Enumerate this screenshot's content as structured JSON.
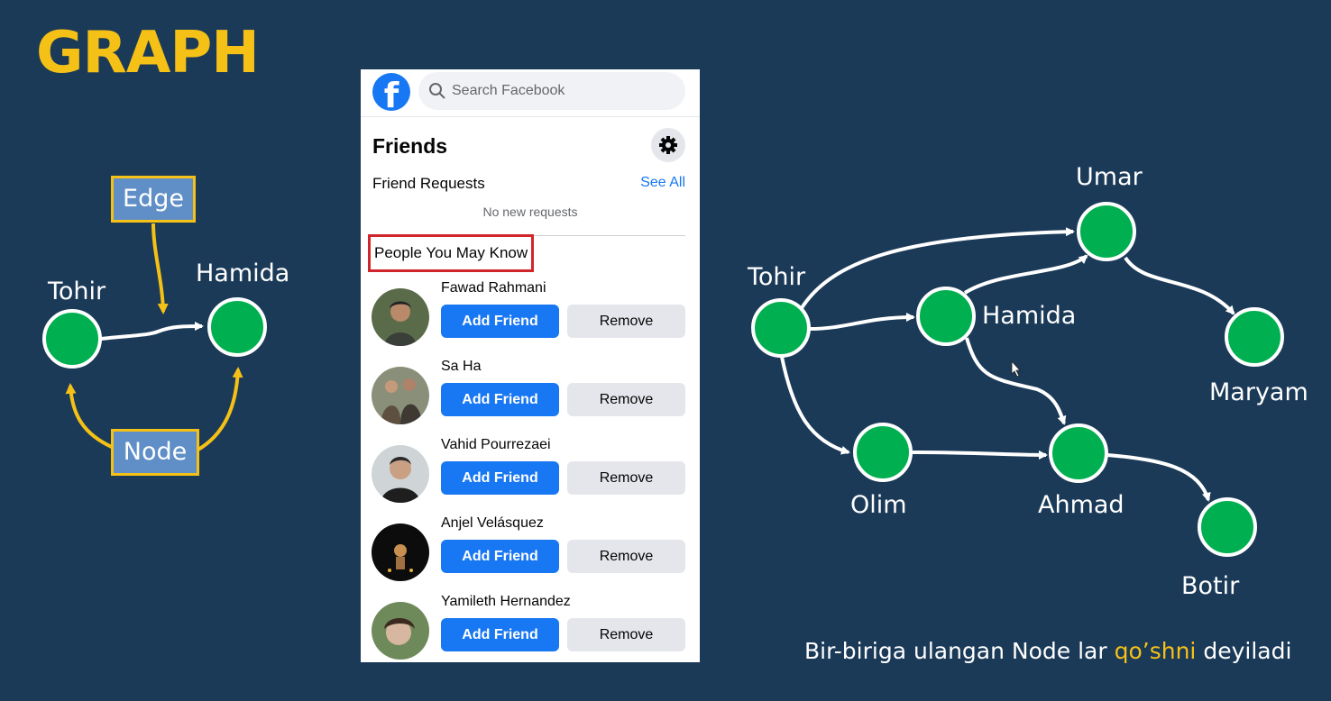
{
  "slide": {
    "title": "GRAPH",
    "caption_before": "Bir-biriga ulangan Node lar ",
    "caption_highlight": "qo’shni",
    "caption_after": " deyiladi"
  },
  "left_diagram": {
    "edge_tag": "Edge",
    "node_tag": "Node",
    "node_a": "Tohir",
    "node_b": "Hamida"
  },
  "right_graph": {
    "nodes": [
      "Umar",
      "Tohir",
      "Hamida",
      "Maryam",
      "Olim",
      "Ahmad",
      "Botir"
    ]
  },
  "facebook": {
    "logo": "f",
    "search_placeholder": "Search Facebook",
    "friends_heading": "Friends",
    "friend_requests": "Friend Requests",
    "see_all": "See All",
    "no_requests": "No new requests",
    "pymk": "People You May Know",
    "add_label": "Add Friend",
    "remove_label": "Remove",
    "people": [
      {
        "name": "Fawad Rahmani"
      },
      {
        "name": "Sa Ha"
      },
      {
        "name": "Vahid Pourrezaei"
      },
      {
        "name": "Anjel Velásquez"
      },
      {
        "name": "Yamileth Hernandez"
      }
    ]
  },
  "colors": {
    "background": "#1b3a58",
    "accent": "#f5c116",
    "node": "#00b050",
    "fb_blue": "#1877f2"
  }
}
